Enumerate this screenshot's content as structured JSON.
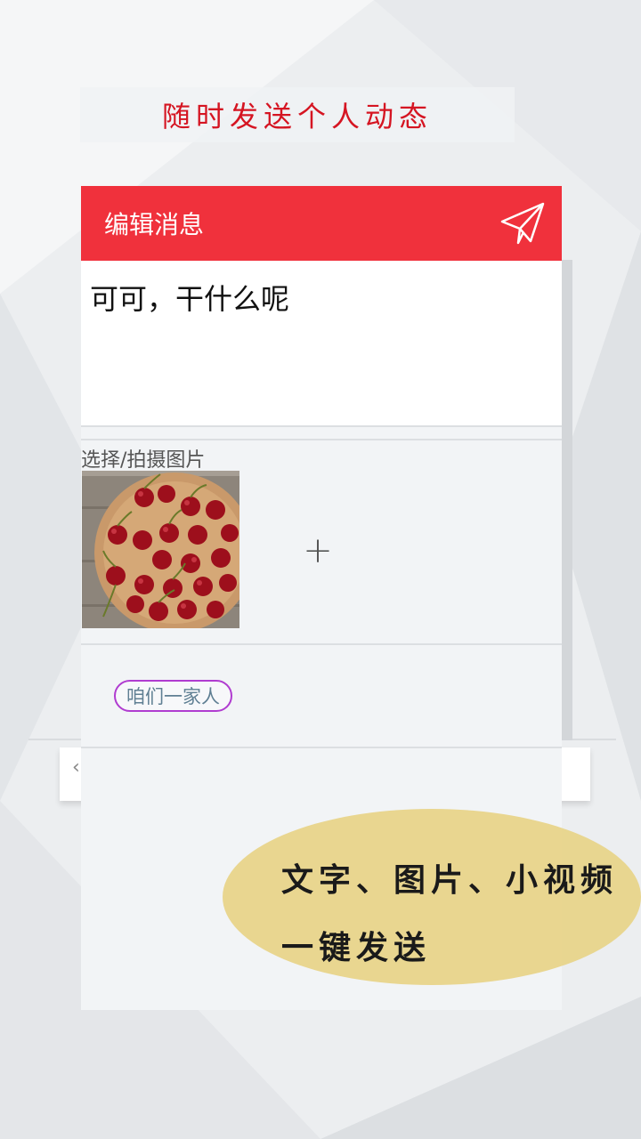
{
  "promo": {
    "title": "随时发送个人动态"
  },
  "app_bar": {
    "title": "编辑消息",
    "send_icon": "paper-plane-icon"
  },
  "message": {
    "text": "可可，干什么呢"
  },
  "images": {
    "label": "选择/拍摄图片",
    "add_label": "+"
  },
  "group": {
    "tag": "咱们一家人"
  },
  "callout": {
    "line1": "文字、图片、小视频",
    "line2": "一键发送"
  },
  "colors": {
    "accent": "#f0313c",
    "promo_red": "#d51522",
    "tag_border": "#b03cd0",
    "callout_bg": "#e8d48a"
  }
}
